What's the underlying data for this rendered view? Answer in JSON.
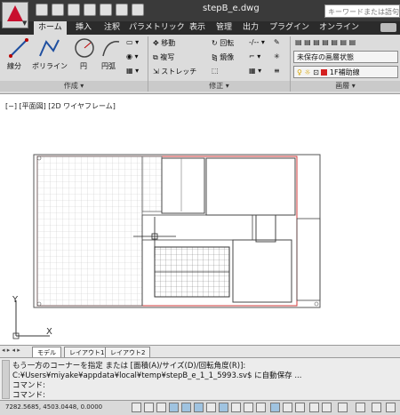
{
  "window": {
    "title": "stepB_e.dwg",
    "search_placeholder": "キーワードまたは語句を"
  },
  "ribbon_tabs": [
    {
      "label": "ホーム",
      "active": true
    },
    {
      "label": "挿入",
      "active": false
    },
    {
      "label": "注釈",
      "active": false
    },
    {
      "label": "パラメトリック",
      "active": false
    },
    {
      "label": "表示",
      "active": false
    },
    {
      "label": "管理",
      "active": false
    },
    {
      "label": "出力",
      "active": false
    },
    {
      "label": "プラグイン",
      "active": false
    },
    {
      "label": "オンライン",
      "active": false
    }
  ],
  "panels": {
    "draw": {
      "title": "作成 ▾",
      "tools": [
        "線分",
        "ポリライン",
        "円",
        "円弧"
      ]
    },
    "modify": {
      "title": "修正 ▾",
      "tools": [
        "移動",
        "回転",
        "複写",
        "鏡像",
        "ストレッチ"
      ]
    },
    "layers": {
      "title": "画層 ▾",
      "layer_state": "未保存の画層状態",
      "current_layer": "1F補助線"
    }
  },
  "viewport": {
    "label": "[−] [平面図] [2D ワイヤフレーム]",
    "ucs_y": "Y",
    "ucs_x": "X"
  },
  "layout_tabs": [
    {
      "label": "モデル",
      "active": true
    },
    {
      "label": "レイアウト1",
      "active": false
    },
    {
      "label": "レイアウト2",
      "active": false
    }
  ],
  "command_line": {
    "history_1": "もう一方のコーナーを指定 または [面積(A)/サイズ(D)/回転角度(R)]:",
    "history_2": "C:¥Users¥miyake¥appdata¥local¥temp¥stepB_e_1_1_5993.sv$ に自動保存 ...",
    "history_3": "コマンド:",
    "prompt": "コマンド:"
  },
  "status_bar": {
    "coordinates": "7282.5685, 4503.0448, 0.0000"
  },
  "colors": {
    "accent_red": "#c8102e",
    "layer_swatch": "#d42020",
    "drawing_red": "#d23a3a"
  }
}
